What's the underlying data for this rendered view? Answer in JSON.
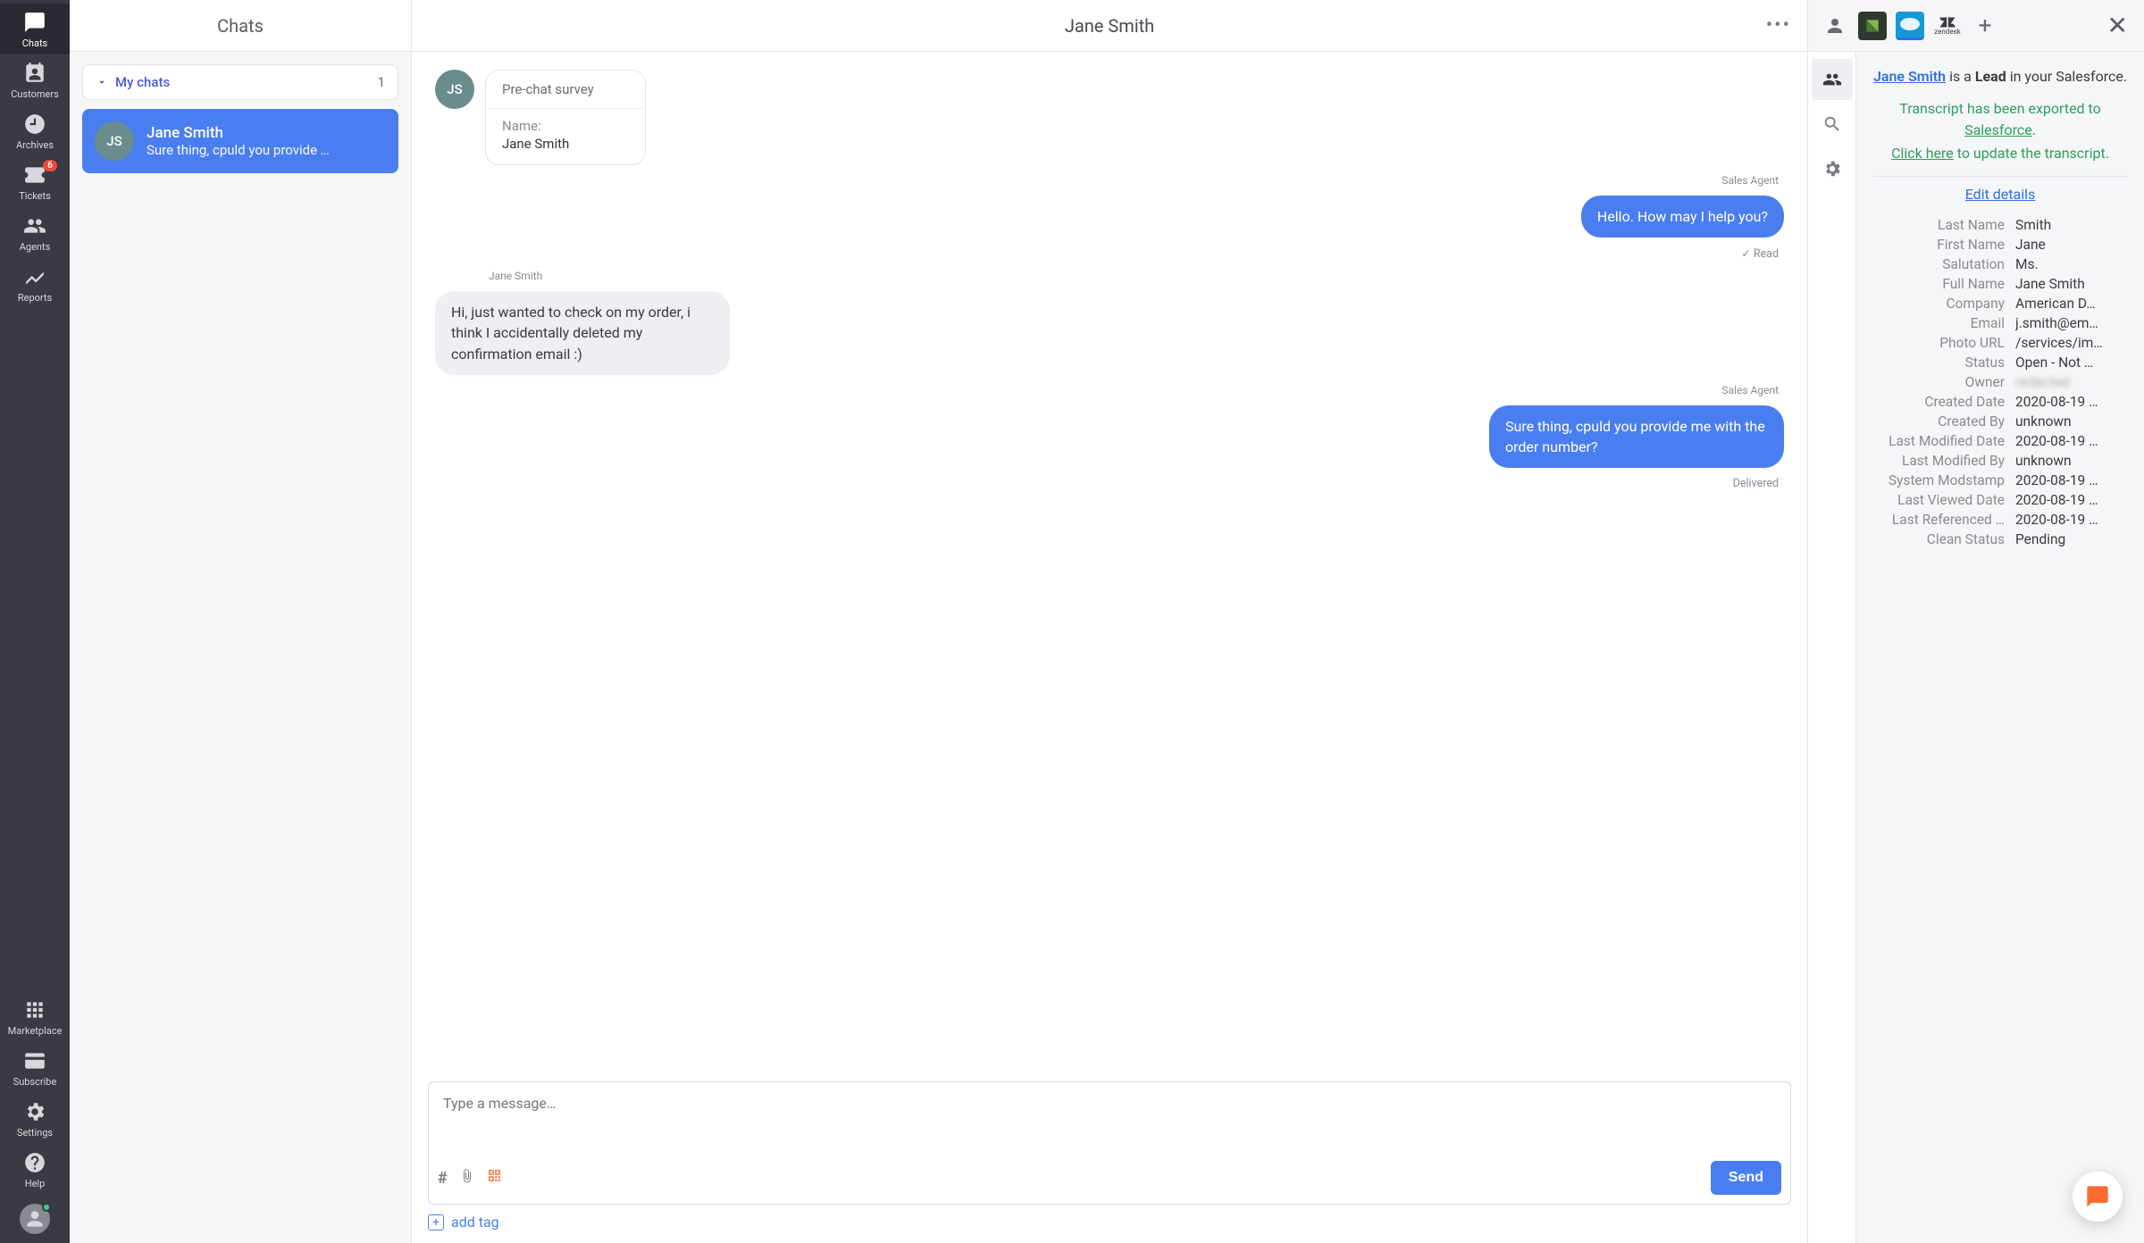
{
  "rail": {
    "chats": "Chats",
    "customers": "Customers",
    "archives": "Archives",
    "tickets": "Tickets",
    "tickets_badge": "6",
    "agents": "Agents",
    "reports": "Reports",
    "marketplace": "Marketplace",
    "subscribe": "Subscribe",
    "settings": "Settings",
    "help": "Help"
  },
  "chats_column": {
    "header": "Chats",
    "my_chats_label": "My chats",
    "my_chats_count": "1",
    "items": [
      {
        "initials": "JS",
        "name": "Jane Smith",
        "preview": "Sure thing, cpuld you provide …"
      }
    ]
  },
  "conversation": {
    "title": "Jane Smith",
    "survey": {
      "heading": "Pre-chat survey",
      "name_label": "Name:",
      "name_value": "Jane Smith",
      "avatar_initials": "JS"
    },
    "messages": [
      {
        "side": "agent",
        "sender": "Sales Agent",
        "text": "Hello. How may I help you?",
        "status": "Read"
      },
      {
        "side": "customer",
        "sender": "Jane Smith",
        "text": "Hi, just wanted to check on my order, i think I accidentally deleted my confirmation email :)"
      },
      {
        "side": "agent",
        "sender": "Sales Agent",
        "text": "Sure thing, cpuld you provide me with the order number?",
        "status": "Delivered"
      }
    ],
    "composer_placeholder": "Type a message…",
    "send_label": "Send",
    "add_tag_label": "add tag"
  },
  "right_panel": {
    "intro_name": "Jane Smith",
    "intro_mid": " is a ",
    "intro_bold": "Lead",
    "intro_tail": " in your Salesforce.",
    "export_line1": "Transcript has been exported to ",
    "export_link": "Salesforce",
    "export_period": ".",
    "update_link": "Click here",
    "update_tail": " to update the transcript.",
    "edit_details": "Edit details",
    "fields": [
      {
        "label": "Last Name",
        "value": "Smith"
      },
      {
        "label": "First Name",
        "value": "Jane"
      },
      {
        "label": "Salutation",
        "value": "Ms."
      },
      {
        "label": "Full Name",
        "value": "Jane Smith"
      },
      {
        "label": "Company",
        "value": "American D…"
      },
      {
        "label": "Email",
        "value": "j.smith@em…"
      },
      {
        "label": "Photo URL",
        "value": "/services/im…"
      },
      {
        "label": "Status",
        "value": "Open - Not …"
      },
      {
        "label": "Owner",
        "value": "redacted",
        "blur": true
      },
      {
        "label": "Created Date",
        "value": "2020-08-19 …"
      },
      {
        "label": "Created By",
        "value": "unknown"
      },
      {
        "label": "Last Modified Date",
        "value": "2020-08-19 …"
      },
      {
        "label": "Last Modified By",
        "value": "unknown"
      },
      {
        "label": "System Modstamp",
        "value": "2020-08-19 …"
      },
      {
        "label": "Last Viewed Date",
        "value": "2020-08-19 …"
      },
      {
        "label": "Last Referenced …",
        "value": "2020-08-19 …"
      },
      {
        "label": "Clean Status",
        "value": "Pending"
      }
    ]
  }
}
